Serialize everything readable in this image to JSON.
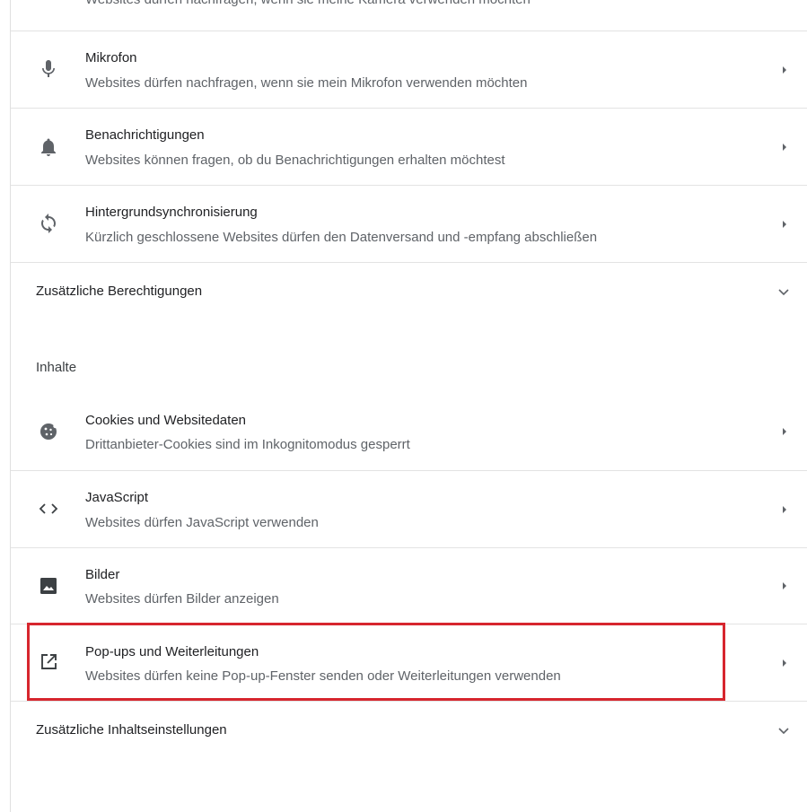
{
  "partial_row_text": "Websites dürfen nachfragen, wenn sie meine Kamera verwenden möchten",
  "permissions": [
    {
      "icon": "microphone-icon",
      "title": "Mikrofon",
      "subtitle": "Websites dürfen nachfragen, wenn sie mein Mikrofon verwenden möchten"
    },
    {
      "icon": "bell-icon",
      "title": "Benachrichtigungen",
      "subtitle": "Websites können fragen, ob du Benachrichtigungen erhalten möchtest"
    },
    {
      "icon": "sync-icon",
      "title": "Hintergrundsynchronisierung",
      "subtitle": "Kürzlich geschlossene Websites dürfen den Datenversand und -empfang abschließen"
    }
  ],
  "additional_permissions_label": "Zusätzliche Berechtigungen",
  "content_section_title": "Inhalte",
  "content": [
    {
      "icon": "cookie-icon",
      "title": "Cookies und Websitedaten",
      "subtitle": "Drittanbieter-Cookies sind im Inkognitomodus gesperrt"
    },
    {
      "icon": "code-icon",
      "title": "JavaScript",
      "subtitle": "Websites dürfen JavaScript verwenden"
    },
    {
      "icon": "image-icon",
      "title": "Bilder",
      "subtitle": "Websites dürfen Bilder anzeigen"
    },
    {
      "icon": "open-in-new-icon",
      "title": "Pop-ups und Weiterleitungen",
      "subtitle": "Websites dürfen keine Pop-up-Fenster senden oder Weiterleitungen verwenden"
    }
  ],
  "additional_content_label": "Zusätzliche Inhaltseinstellungen",
  "colors": {
    "highlight": "#d7262e",
    "icon": "#5f6368",
    "divider": "#e3e3e3"
  }
}
